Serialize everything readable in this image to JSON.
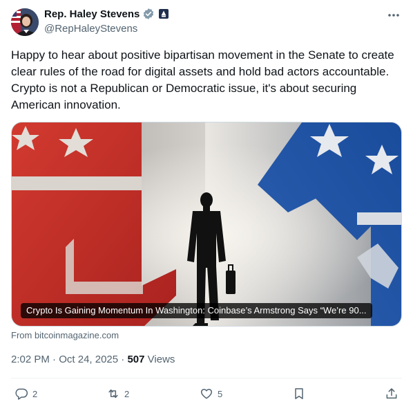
{
  "author": {
    "name": "Rep. Haley Stevens",
    "handle": "@RepHaleyStevens"
  },
  "tweet": {
    "text": "Happy to hear about positive bipartisan movement in the Senate to create clear rules of the road for digital assets and hold bad actors accountable. Crypto is not a Republican or Democratic issue, it's about securing American innovation."
  },
  "card": {
    "caption": "Crypto Is Gaining Momentum In Washington: Coinbase’s Armstrong Says “We’re 90...",
    "source": "From bitcoinmagazine.com"
  },
  "meta": {
    "time": "2:02 PM",
    "sep1": "·",
    "date": "Oct 24, 2025",
    "sep2": "·",
    "views_count": "507",
    "views_label": "Views"
  },
  "actions": {
    "replies": "2",
    "reposts": "2",
    "likes": "5"
  },
  "colors": {
    "verified": "#829aab",
    "text_secondary": "#536471",
    "republican_red": "#c8302b",
    "democrat_blue": "#1d4f9e"
  },
  "icons": [
    "verified-badge-icon",
    "gov-badge-icon",
    "more-icon",
    "reply-icon",
    "repost-icon",
    "like-icon",
    "bookmark-icon",
    "share-icon"
  ]
}
